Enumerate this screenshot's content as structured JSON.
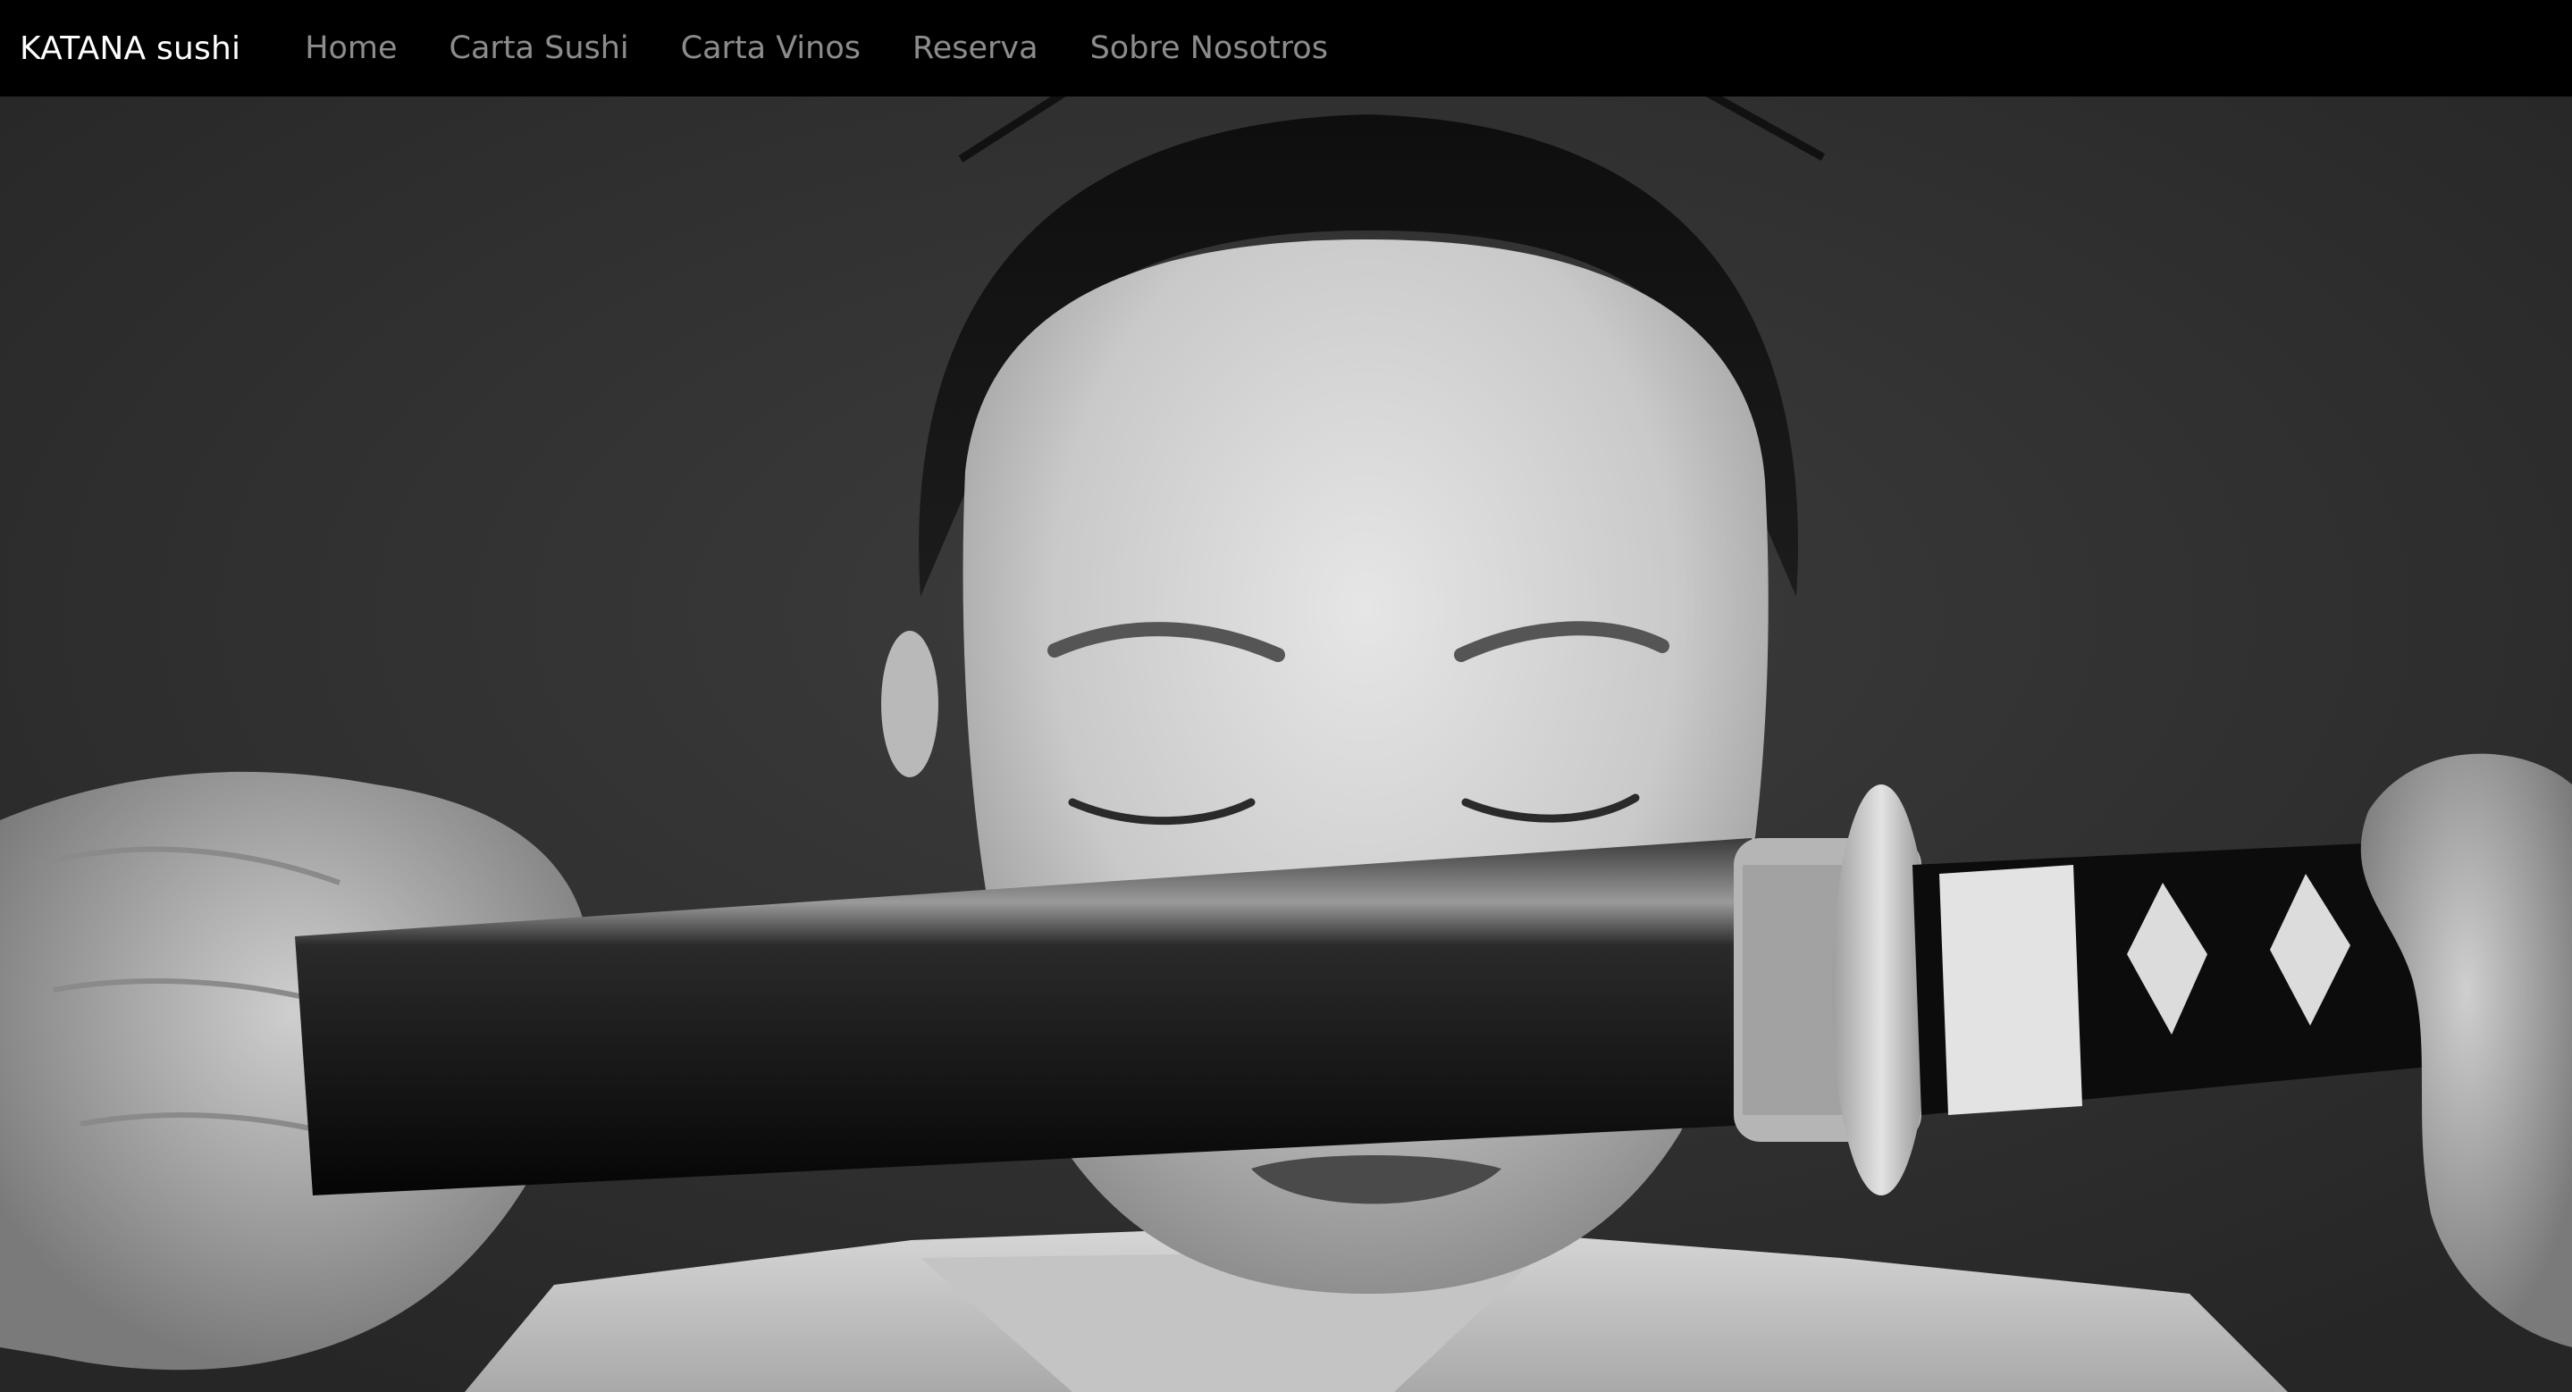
{
  "navbar": {
    "brand": "KATANA sushi",
    "links": [
      {
        "label": "Home"
      },
      {
        "label": "Carta Sushi"
      },
      {
        "label": "Carta Vinos"
      },
      {
        "label": "Reserva"
      },
      {
        "label": "Sobre Nosotros"
      }
    ]
  },
  "hero": {
    "image_subject": "black-and-white portrait of a woman with closed eyes holding a katana horizontally in front of her face"
  },
  "colors": {
    "navbar_background": "#000000",
    "brand_text": "#ffffff",
    "nav_link_text": "#8c8c8c",
    "hero_background": "#2f2f2f"
  }
}
